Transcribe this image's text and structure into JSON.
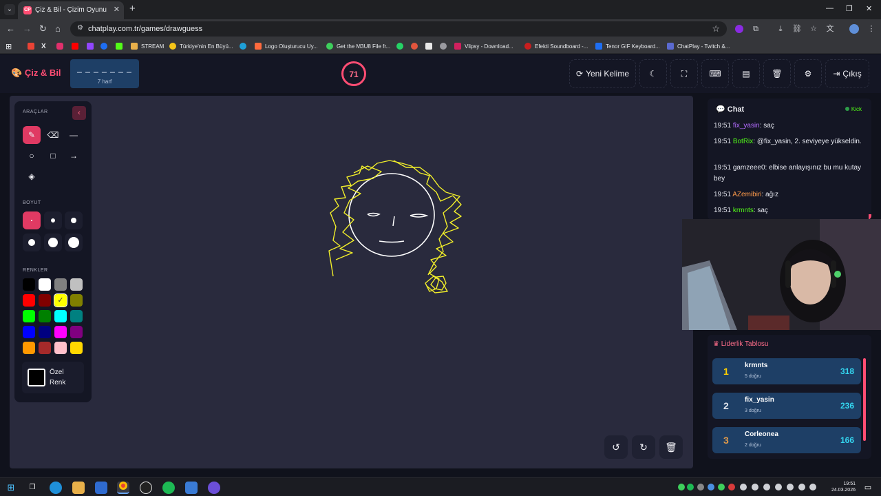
{
  "browser": {
    "tab_title": "Çiz & Bil - Çizim Oyunu",
    "tab_favicon": "CP",
    "url": "chatplay.com.tr/games/drawguess",
    "bookmarks": [
      "STREAM",
      "Türkiye'nin En Büyü...",
      "Logo Oluşturucu Uy...",
      "Get the M3U8 File fr...",
      "Vlipsy - Download...",
      "Efekti Soundboard -...",
      "Tenor GIF Keyboard...",
      "ChatPlay - Twitch &..."
    ]
  },
  "header": {
    "brand": "Çiz & Bil",
    "word_blanks": "_ _ _ _ _ _ _",
    "word_hint": "7 harf",
    "timer": "71",
    "new_word_label": "Yeni Kelime",
    "exit_label": "Çıkış"
  },
  "tools": {
    "tools_heading": "ARAÇLAR",
    "size_heading": "BOYUT",
    "colors_heading": "RENKLER",
    "custom_color_label": "Özel Renk",
    "palette": [
      "#000000",
      "#ffffff",
      "#808080",
      "#c0c0c0",
      "#ff0000",
      "#800000",
      "#ffff00",
      "#808000",
      "#00ff00",
      "#008000",
      "#00ffff",
      "#008080",
      "#0000ff",
      "#000080",
      "#ff00ff",
      "#800080",
      "#ff9800",
      "#a52a2a",
      "#ffc0cb",
      "#ffd700"
    ],
    "selected_color": "#ffff00"
  },
  "chat": {
    "title": "Chat",
    "platform": "Kick",
    "messages": [
      {
        "time": "19:51",
        "user": "fix_yasin",
        "user_color": "#b36bff",
        "text": ": saç"
      },
      {
        "time": "19:51",
        "user": "BotRix",
        "user_color": "#53fc18",
        "text": ": @fix_yasin, 2. seviyeye yükseldin."
      },
      {
        "time": "19:51",
        "user": "",
        "user_color": "#e6e8f0",
        "text": "gamzeee0: elbise anlayışınız bu mu kutay bey"
      },
      {
        "time": "19:51",
        "user": "AZemibiri",
        "user_color": "#ff9b4a",
        "text": ": ağız"
      },
      {
        "time": "19:51",
        "user": "krmnts",
        "user_color": "#53fc18",
        "text": ": saç"
      }
    ]
  },
  "leaderboard": {
    "title": "Liderlik Tablosu",
    "rows": [
      {
        "rank": "1",
        "rank_color": "#ffd000",
        "name": "krmnts",
        "sub": "5 doğru",
        "score": "318"
      },
      {
        "rank": "2",
        "rank_color": "#e0e4ec",
        "name": "fix_yasin",
        "sub": "3 doğru",
        "score": "236"
      },
      {
        "rank": "3",
        "rank_color": "#e09a4a",
        "name": "Corleonea",
        "sub": "2 doğru",
        "score": "166"
      }
    ]
  },
  "taskbar": {
    "time": "19:51",
    "date": "24.03.2026"
  }
}
